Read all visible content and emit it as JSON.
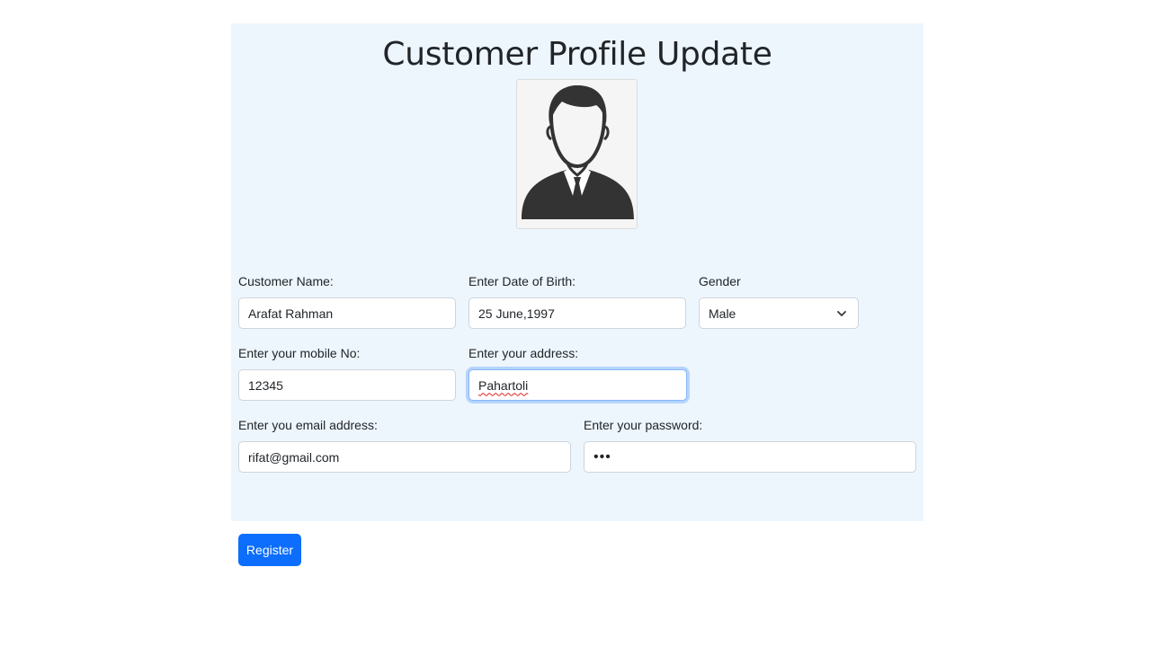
{
  "page": {
    "title": "Customer Profile Update"
  },
  "avatar": {
    "icon": "user-avatar-icon"
  },
  "form": {
    "customer_name": {
      "label": "Customer Name:",
      "value": "Arafat Rahman"
    },
    "dob": {
      "label": "Enter Date of Birth:",
      "value": "25 June,1997"
    },
    "gender": {
      "label": "Gender",
      "value": "Male"
    },
    "mobile": {
      "label": "Enter your mobile No:",
      "value": "12345"
    },
    "address": {
      "label": "Enter your address:",
      "value": "Pahartoli"
    },
    "email": {
      "label": "Enter you email address:",
      "value": "rifat@gmail.com"
    },
    "password": {
      "label": "Enter your password:",
      "value": "•••"
    }
  },
  "actions": {
    "register_label": "Register"
  },
  "colors": {
    "panel_bg": "#eef6fd",
    "primary": "#0d6efd",
    "focus_border": "#86b7fe"
  }
}
